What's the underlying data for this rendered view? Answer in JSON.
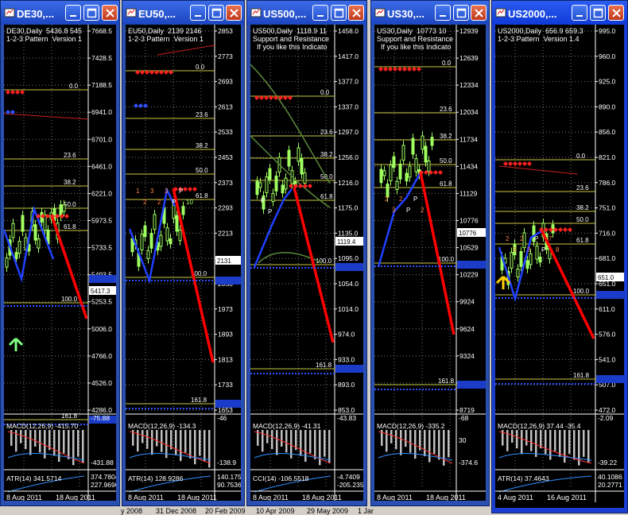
{
  "bottom_axis_labels": [
    "y 2008",
    "31 Dec 2008",
    "20 Feb 2009",
    "10 Apr 2009",
    "29 May 2009",
    "1 Jar"
  ],
  "colors": {
    "pivot_marker": "#ff2020",
    "trend_line": "#ff0000",
    "zigzag": "#2040ff",
    "fib": "#c8c840",
    "candle": "#a0ff60",
    "price_box": "#1a3cc8"
  },
  "windows": [
    {
      "title": "DE30,...",
      "info": [
        "DE30,Daily  5436.8 545",
        "1-2-3 Pattern  Version 1"
      ],
      "price_ticks": [
        "7668.5",
        "7428.5",
        "7188.5",
        "6941.0",
        "6701.0",
        "6461.0",
        "6221.0",
        "5973.5",
        "5733.5",
        "5493.5",
        "5253.5",
        "5006.0",
        "4766.0",
        "4526.0",
        "4286.0"
      ],
      "fib_labels": [
        "0.0",
        "23.6",
        "38.2",
        "50.0",
        "61.8",
        "100.0",
        "161.8"
      ],
      "current_price": "5417.3",
      "pattern_labels": [],
      "macd_label": "MACD(12,26,9)  -415.70",
      "macd_ticks": [
        "-75.88",
        "-431.88"
      ],
      "atr_label": "ATR(14) 341.5714",
      "atr_ticks": [
        "374.7804",
        "227.9696"
      ],
      "dates": [
        "8 Aug 2011",
        "18 Aug 2011"
      ]
    },
    {
      "title": "EU50,...",
      "info": [
        "EU50,Daily  2139 2146",
        "1-2-3 Pattern  Version 1"
      ],
      "price_ticks": [
        "2853",
        "2773",
        "2693",
        "2613",
        "2533",
        "2453",
        "2373",
        "2293",
        "2213",
        "2131",
        "2053",
        "1973",
        "1893",
        "1813",
        "1733",
        "1653"
      ],
      "fib_labels": [
        "0.0",
        "23.6",
        "38.2",
        "50.0",
        "61.8",
        "100.0",
        "161.8"
      ],
      "current_price": "2131",
      "pattern_labels": [
        "1",
        "2",
        "3",
        "2",
        "3",
        "P",
        "P",
        "10"
      ],
      "macd_label": "MACD(12,26,9)  -134.3",
      "macd_ticks": [
        "-46",
        "-138.9"
      ],
      "atr_label": "ATR(14) 128.9286",
      "atr_ticks": [
        "140.175",
        "90.7536"
      ],
      "dates": [
        "8 Aug 2011",
        "18 Aug 2011"
      ]
    },
    {
      "title": "US500,...",
      "info": [
        "US500,Daily  1118.9 11",
        "Support and Resistance",
        "  If you like this Indicato"
      ],
      "price_ticks": [
        "1458.0",
        "1417.0",
        "1377.0",
        "1337.0",
        "1297.0",
        "1256.0",
        "1216.0",
        "1175.0",
        "1135.0",
        "1095.0",
        "1054.0",
        "1014.0",
        "974.0",
        "933.0",
        "893.0",
        "853.0"
      ],
      "fib_labels": [
        "0.0",
        "23.6",
        "38.2",
        "50.0",
        "61.8",
        "100.0",
        "161.8"
      ],
      "current_price": "1119.4",
      "pattern_labels": [
        "P",
        "P"
      ],
      "macd_label": "MACD(12,26,9)  -41.31",
      "macd_ticks": [
        "-43.83"
      ],
      "atr_label": "CCI(14) -106.5518",
      "atr_ticks": [
        "-4.7409",
        "-205.235"
      ],
      "dates": [
        "8 Aug 2011",
        "18 Aug 2011"
      ]
    },
    {
      "title": "US30,...",
      "info": [
        "US30,Daily  10773 10",
        "Support and Resistance",
        "  If you like this Indicato"
      ],
      "price_ticks": [
        "12939",
        "12639",
        "12334",
        "12034",
        "11734",
        "11434",
        "11129",
        "10776",
        "10529",
        "10229",
        "9924",
        "9624",
        "9324",
        "9024",
        "8719"
      ],
      "fib_labels": [
        "0.0",
        "23.6",
        "38.2",
        "50.0",
        "61.8",
        "100.0",
        "161.8"
      ],
      "current_price": "10776",
      "pattern_labels": [
        "2",
        "3",
        "2",
        "P",
        "P",
        "2"
      ],
      "macd_label": "MACD(12,26,9)  -335.2",
      "macd_ticks": [
        "-68",
        "30",
        "-374.6"
      ],
      "atr_label": "",
      "atr_ticks": [],
      "dates": [
        "8 Aug 2011",
        "18 Aug 2011"
      ]
    },
    {
      "title": "US2000,...",
      "info": [
        "US2000,Daily  656.9 659.3",
        "1-2-3 Pattern  Version 1.4"
      ],
      "price_ticks": [
        "995.0",
        "960.0",
        "925.0",
        "890.0",
        "856.0",
        "821.0",
        "786.0",
        "751.0",
        "716.0",
        "681.0",
        "651.0",
        "611.0",
        "576.0",
        "541.0",
        "507.0",
        "472.0"
      ],
      "fib_labels": [
        "0.0",
        "23.6",
        "38.2",
        "50.0",
        "61.8",
        "100.0",
        "161.8"
      ],
      "current_price": "651.0",
      "pattern_labels": [
        "2",
        "3",
        "2",
        "3",
        "P",
        "P",
        "7",
        "8"
      ],
      "macd_label": "MACD(12,26,9)  37.44  -35.4",
      "macd_ticks": [
        "-2.09",
        "-39.22"
      ],
      "atr_label": "ATR(14) 37.4643",
      "atr_ticks": [
        "40.1086",
        "20.2771"
      ],
      "dates": [
        "4 Aug 2011",
        "16 Aug 2011"
      ]
    }
  ]
}
